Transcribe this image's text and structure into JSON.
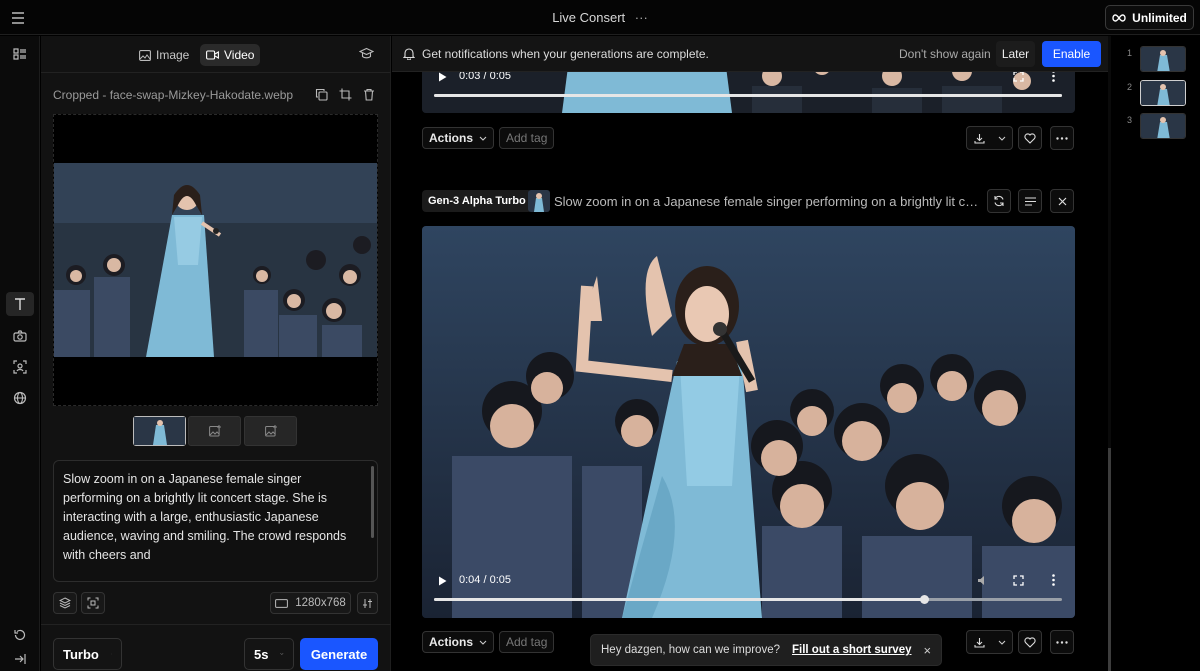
{
  "header": {
    "title": "Live Consert",
    "more": "···",
    "plan_badge": "Unlimited"
  },
  "panel": {
    "modes": [
      "Image",
      "Video"
    ],
    "active_mode": "Video",
    "file_name": "Cropped - face-swap-Mizkey-Hakodate.webp",
    "prompt_text": "Slow zoom in on a Japanese female singer performing on a brightly lit concert stage. She is interacting with a large, enthusiastic Japanese audience, waving and smiling. The crowd responds with cheers and",
    "resolution": "1280x768",
    "model_select": "Turbo",
    "duration_select": "5s",
    "generate_label": "Generate"
  },
  "notification": {
    "text": "Get notifications when your generations are complete.",
    "dismiss": "Don't show again",
    "later": "Later",
    "enable": "Enable"
  },
  "feed": {
    "items": [
      {
        "time": "0:03 / 0:05",
        "progress": 1.0,
        "actions_label": "Actions",
        "tag_placeholder": "Add tag"
      },
      {
        "model": "Gen-3 Alpha Turbo",
        "prompt": "Slow zoom in on a Japanese female singer performing on a brightly lit conc...",
        "time": "0:04 / 0:05",
        "progress": 0.78,
        "actions_label": "Actions",
        "tag_placeholder": "Add tag"
      }
    ]
  },
  "survey": {
    "text": "Hey dazgen, how can we improve?",
    "link": "Fill out a short survey",
    "close": "×"
  },
  "strip": {
    "numbers": [
      "1",
      "2",
      "3"
    ],
    "selected": 2
  },
  "colors": {
    "accent": "#1a56ff",
    "background": "#000000",
    "panel": "#121212",
    "dress": "#7fbad6"
  }
}
